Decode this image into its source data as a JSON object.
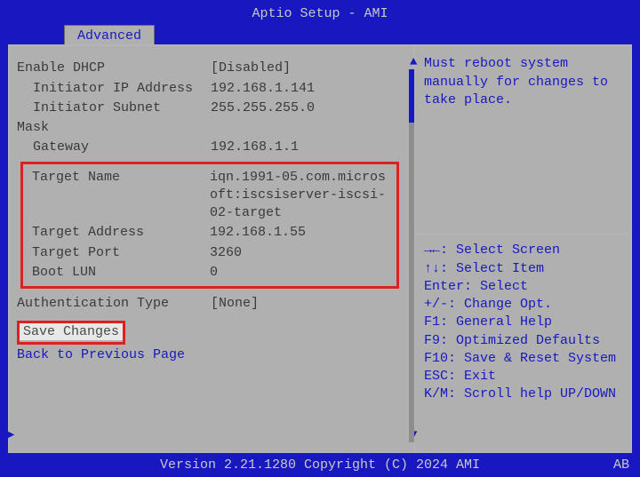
{
  "title": "Aptio Setup - AMI",
  "tab": "Advanced",
  "settings": {
    "enable_dhcp_label": "Enable DHCP",
    "enable_dhcp_value": "[Disabled]",
    "initiator_ip_label": "Initiator IP Address",
    "initiator_ip_value": "192.168.1.141",
    "initiator_subnet_label": "Initiator Subnet",
    "initiator_subnet_value": "255.255.255.0",
    "mask_label": "Mask",
    "gateway_label": "Gateway",
    "gateway_value": "192.168.1.1"
  },
  "target": {
    "name_label": "Target Name",
    "name_value": "iqn.1991-05.com.microsoft:iscsiserver-iscsi-02-target",
    "address_label": "Target Address",
    "address_value": "192.168.1.55",
    "port_label": "Target Port",
    "port_value": "3260",
    "boot_lun_label": "Boot LUN",
    "boot_lun_value": "0"
  },
  "auth": {
    "type_label": "Authentication Type",
    "type_value": "[None]"
  },
  "actions": {
    "save_label": "Save Changes",
    "back_label": "Back to Previous Page"
  },
  "help": {
    "text": "Must reboot system manually for changes to take place."
  },
  "hints": {
    "h1": "→←: Select Screen",
    "h2": "↑↓: Select Item",
    "h3": "Enter: Select",
    "h4": "+/-: Change Opt.",
    "h5": "F1: General Help",
    "h6": "F9: Optimized Defaults",
    "h7": "F10: Save & Reset System",
    "h8": "ESC: Exit",
    "h9": "K/M: Scroll help UP/DOWN"
  },
  "footer": "Version 2.21.1280 Copyright (C) 2024 AMI",
  "indicator": "AB"
}
